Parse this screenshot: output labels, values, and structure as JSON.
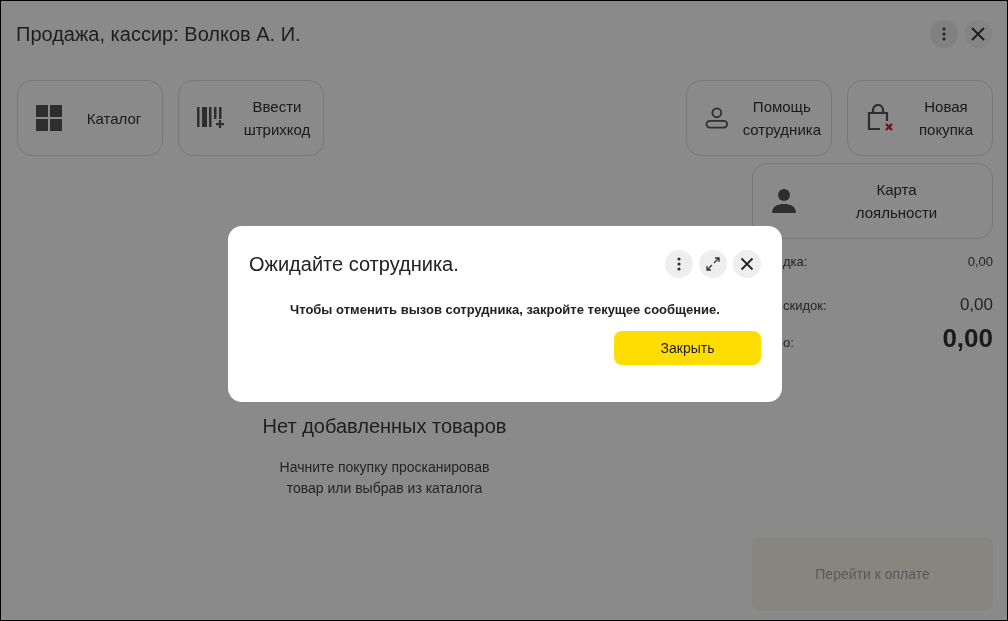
{
  "window": {
    "title": "Продажа, кассир: Волков А. И."
  },
  "actions_left": [
    {
      "label": "Каталог"
    },
    {
      "label": "Ввести штрихкод"
    }
  ],
  "actions_right": [
    {
      "label": "Помощь сотрудника"
    },
    {
      "label": "Новая покупка"
    }
  ],
  "loyalty_card": {
    "label": "Карта лояльности"
  },
  "summary": [
    {
      "label": "дка:",
      "value": "0,00",
      "kind": "small"
    },
    {
      "label": "скидок:",
      "value": "0,00",
      "kind": "medium"
    },
    {
      "label": "о:",
      "value": "0,00",
      "kind": "total"
    }
  ],
  "empty_state": {
    "title": "Нет добавленных товаров",
    "text": "Начните покупку просканировав товар или выбрав из каталога"
  },
  "pay_button": {
    "label": "Перейти к оплате",
    "disabled": true
  },
  "dialog": {
    "title": "Ожидайте сотрудника.",
    "message": "Чтобы отменить вызов сотрудника, закройте текущее сообщение.",
    "button": "Закрыть"
  }
}
